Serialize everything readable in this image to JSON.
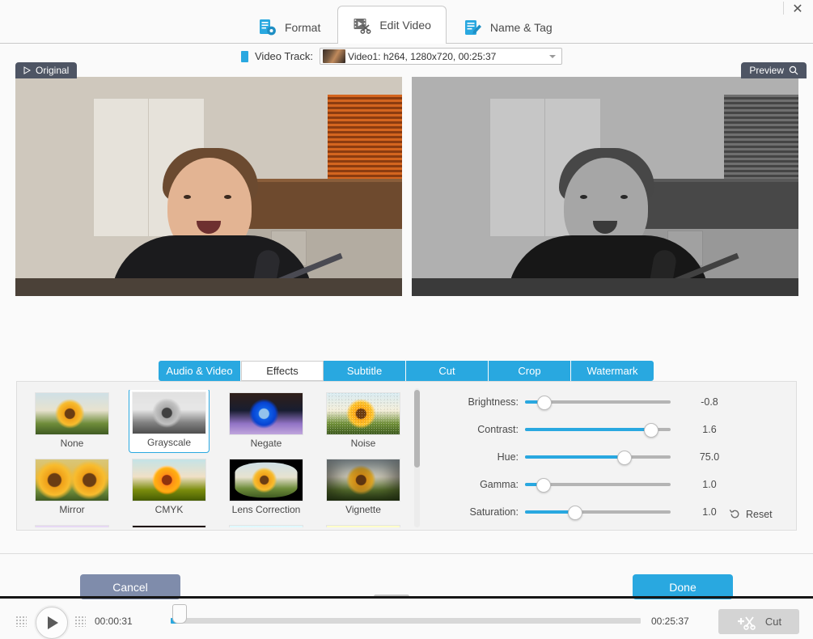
{
  "window": {
    "close_icon": "close-icon"
  },
  "top_tabs": [
    {
      "label": "Format",
      "icon": "format-document-gear-icon",
      "active": false
    },
    {
      "label": "Edit Video",
      "icon": "film-scissors-icon",
      "active": true
    },
    {
      "label": "Name & Tag",
      "icon": "document-pencil-icon",
      "active": false
    }
  ],
  "track": {
    "icon": "video-track-icon",
    "label": "Video Track:",
    "value": "Video1: h264, 1280x720, 00:25:37",
    "caret_icon": "chevron-down-icon"
  },
  "preview": {
    "original_badge": "Original",
    "original_icon": "play-triangle-icon",
    "preview_badge": "Preview",
    "preview_icon": "magnifier-icon"
  },
  "transport": {
    "play_icon": "play-icon",
    "grip_left_icon": "grip-dots-icon",
    "grip_right_icon": "grip-dots-icon",
    "current_time": "00:00:31",
    "total_time": "00:25:37",
    "progress_percent": 2.2,
    "cut_label": "Cut",
    "cut_icon": "add-scissors-icon"
  },
  "panel_tabs": [
    {
      "label": "Audio & Video",
      "active": false
    },
    {
      "label": "Effects",
      "active": true
    },
    {
      "label": "Subtitle",
      "active": false
    },
    {
      "label": "Cut",
      "active": false
    },
    {
      "label": "Crop",
      "active": false
    },
    {
      "label": "Watermark",
      "active": false
    }
  ],
  "effects": {
    "selected": "Grayscale",
    "items": [
      {
        "label": "None",
        "style": "sun"
      },
      {
        "label": "Grayscale",
        "style": "sun gray"
      },
      {
        "label": "Negate",
        "style": "sun neg"
      },
      {
        "label": "Noise",
        "style": "sun noise"
      },
      {
        "label": "Mirror",
        "style": "sun mirror"
      },
      {
        "label": "CMYK",
        "style": "sun cmyk"
      },
      {
        "label": "Lens Correction",
        "style": "sun lens"
      },
      {
        "label": "Vignette",
        "style": "sun vig"
      },
      {
        "label": "",
        "style": "sun green"
      },
      {
        "label": "",
        "style": "sun edge"
      },
      {
        "label": "",
        "style": "sun sharp"
      },
      {
        "label": "",
        "style": "sun sepia"
      }
    ]
  },
  "sliders": [
    {
      "label": "Brightness:",
      "value": "-0.8",
      "percent": 13
    },
    {
      "label": "Contrast:",
      "value": "1.6",
      "percent": 86
    },
    {
      "label": "Hue:",
      "value": "75.0",
      "percent": 68
    },
    {
      "label": "Gamma:",
      "value": "1.0",
      "percent": 12
    },
    {
      "label": "Saturation:",
      "value": "1.0",
      "percent": 34
    }
  ],
  "reset": {
    "label": "Reset",
    "icon": "reset-counterclock-icon"
  },
  "footer": {
    "cancel_label": "Cancel",
    "done_label": "Done"
  },
  "colors": {
    "accent": "#29a8e0",
    "badge_bg": "#4e5564",
    "cancel_bg": "#7f8cab",
    "panel_bg": "#f3f3f3"
  }
}
